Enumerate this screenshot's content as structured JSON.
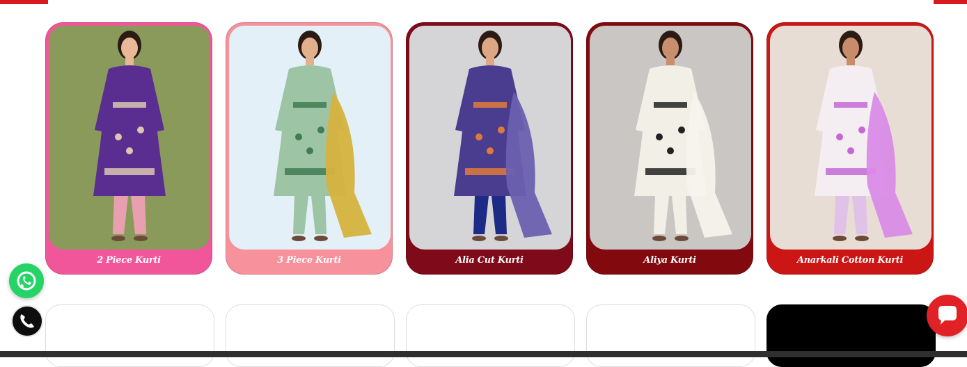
{
  "products": [
    {
      "title": "2 Piece Kurti",
      "card_color": "#f76aa6",
      "label_color": "#f2569a",
      "bg": "#8a9a5b",
      "dress": "#5a2d91",
      "pattern": "#d9c7b0",
      "pants": "#e8a0b0",
      "dupatta": "",
      "skin": "#e9b896"
    },
    {
      "title": "3 Piece Kurti",
      "card_color": "#f9a0a8",
      "label_color": "#f7929c",
      "bg": "#e4f0f7",
      "dress": "#9ec4a6",
      "pattern": "#3f7d52",
      "pants": "#9ec4a6",
      "dupatta": "#d6b23e",
      "skin": "#e2b08c"
    },
    {
      "title": "Alia Cut Kurti",
      "card_color": "#8a0e1f",
      "label_color": "#7f0a19",
      "bg": "#d5d5d8",
      "dress": "#4a3d8f",
      "pattern": "#e07a3a",
      "pants": "#1d2a86",
      "dupatta": "#6a60b0",
      "skin": "#dda685"
    },
    {
      "title": "Aliya Kurti",
      "card_color": "#8a0d12",
      "label_color": "#820a0f",
      "bg": "#c9c6c4",
      "dress": "#f2efe6",
      "pattern": "#222222",
      "pants": "#f2efe6",
      "dupatta": "#f6f3ec",
      "skin": "#c98e6e"
    },
    {
      "title": "Anarkali Cotton Kurti",
      "card_color": "#d31a1a",
      "label_color": "#cc1616",
      "bg": "#e8ddd4",
      "dress": "#f4eef2",
      "pattern": "#c468d6",
      "pants": "#e0c2e8",
      "dupatta": "#d98be6",
      "skin": "#c98c6a"
    }
  ],
  "floating": {
    "whatsapp_icon": "whatsapp-icon",
    "phone_icon": "phone-icon",
    "chat_icon": "chat-icon"
  }
}
